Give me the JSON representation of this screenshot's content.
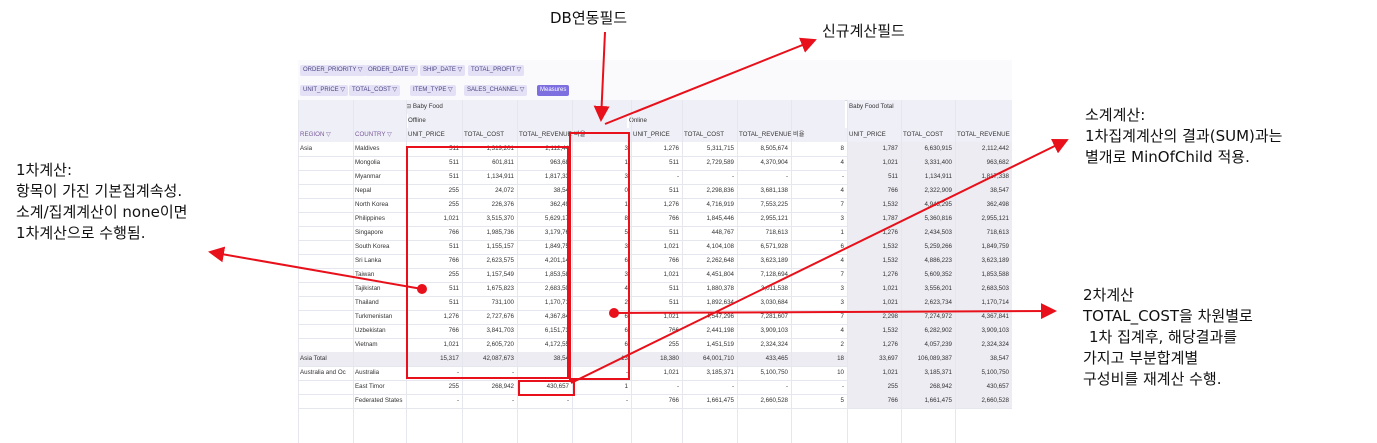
{
  "annotations": {
    "db_field": "DB연동필드",
    "new_field": "신규계산필드",
    "subtotal": [
      "소계계산:",
      "1차집계계산의 결과(SUM)과는",
      "별개로 MinOfChild 적용."
    ],
    "first_calc": [
      "1차계산:",
      "항목이 가진 기본집계속성.",
      "소계/집계계산이 none이면",
      "1차계산으로 수행됨."
    ],
    "second_calc": [
      "2차계산",
      "TOTAL_COST을 차원별로",
      "1차 집계후, 해당결과를",
      "가지고 부분합계별",
      "구성비를 재계산 수행."
    ]
  },
  "toolbar": {
    "filters": [
      "ORDER_PRIORITY ▽",
      "ORDER_DATE ▽",
      "SHIP_DATE ▽",
      "TOTAL_PROFIT ▽"
    ],
    "columns": [
      "UNIT_PRICE ▽",
      "TOTAL_COST ▽",
      "ITEM_TYPE ▽",
      "SALES_CHANNEL ▽",
      "Measures"
    ]
  },
  "colors": {
    "accent": "#7d6fe0",
    "highlight": "#e8101a"
  },
  "pivot": {
    "group": "⊟ Baby Food",
    "group_total": "Baby Food Total",
    "channels": [
      "Offline",
      "Online"
    ],
    "region_header": "REGION ▽",
    "country_header": "COUNTRY ▽",
    "measures": [
      "UNIT_PRICE",
      "TOTAL_COST",
      "TOTAL_REVENUE",
      "비율"
    ],
    "rows": [
      {
        "region": "Asia",
        "country": "Maldives",
        "v": [
          "511",
          "1,319,201",
          "2,112,44",
          "3",
          "1,276",
          "5,311,715",
          "8,505,674",
          "8",
          "1,787",
          "6,630,915",
          "2,112,442"
        ]
      },
      {
        "region": "",
        "country": "Mongolia",
        "v": [
          "511",
          "601,811",
          "963,68",
          "1",
          "511",
          "2,729,589",
          "4,370,904",
          "4",
          "1,021",
          "3,331,400",
          "963,682"
        ]
      },
      {
        "region": "",
        "country": "Myanmar",
        "v": [
          "511",
          "1,134,911",
          "1,817,33",
          "3",
          "-",
          "-",
          "-",
          "-",
          "511",
          "1,134,911",
          "1,817,338"
        ]
      },
      {
        "region": "",
        "country": "Nepal",
        "v": [
          "255",
          "24,072",
          "38,54",
          "0",
          "511",
          "2,298,836",
          "3,681,138",
          "4",
          "766",
          "2,322,909",
          "38,547"
        ]
      },
      {
        "region": "",
        "country": "North Korea",
        "v": [
          "255",
          "226,376",
          "362,49",
          "1",
          "1,276",
          "4,716,919",
          "7,553,225",
          "7",
          "1,532",
          "4,943,295",
          "362,498"
        ]
      },
      {
        "region": "",
        "country": "Philippines",
        "v": [
          "1,021",
          "3,515,370",
          "5,629,17",
          "8",
          "766",
          "1,845,446",
          "2,955,121",
          "3",
          "1,787",
          "5,360,816",
          "2,955,121"
        ]
      },
      {
        "region": "",
        "country": "Singapore",
        "v": [
          "766",
          "1,985,736",
          "3,179,76",
          "5",
          "511",
          "448,767",
          "718,613",
          "1",
          "1,276",
          "2,434,503",
          "718,613"
        ]
      },
      {
        "region": "",
        "country": "South Korea",
        "v": [
          "511",
          "1,155,157",
          "1,849,75",
          "3",
          "1,021",
          "4,104,108",
          "6,571,928",
          "6",
          "1,532",
          "5,259,266",
          "1,849,759"
        ]
      },
      {
        "region": "",
        "country": "Sri Lanka",
        "v": [
          "766",
          "2,623,575",
          "4,201,14",
          "6",
          "766",
          "2,262,648",
          "3,623,189",
          "4",
          "1,532",
          "4,886,223",
          "3,623,189"
        ]
      },
      {
        "region": "",
        "country": "Taiwan",
        "v": [
          "255",
          "1,157,549",
          "1,853,58",
          "3",
          "1,021",
          "4,451,804",
          "7,128,694",
          "7",
          "1,276",
          "5,609,352",
          "1,853,588"
        ]
      },
      {
        "region": "",
        "country": "Tajikistan",
        "v": [
          "511",
          "1,675,823",
          "2,683,50",
          "4",
          "511",
          "1,880,378",
          "3,011,538",
          "3",
          "1,021",
          "3,556,201",
          "2,683,503"
        ]
      },
      {
        "region": "",
        "country": "Thailand",
        "v": [
          "511",
          "731,100",
          "1,170,71",
          "2",
          "511",
          "1,892,634",
          "3,030,684",
          "3",
          "1,021",
          "2,623,734",
          "1,170,714"
        ]
      },
      {
        "region": "",
        "country": "Turkmenistan",
        "v": [
          "1,276",
          "2,727,676",
          "4,367,84",
          "6",
          "1,021",
          "4,547,296",
          "7,281,607",
          "7",
          "2,298",
          "7,274,972",
          "4,367,841"
        ]
      },
      {
        "region": "",
        "country": "Uzbekistan",
        "v": [
          "766",
          "3,841,703",
          "6,151,73",
          "6",
          "766",
          "2,441,198",
          "3,909,103",
          "4",
          "1,532",
          "6,282,902",
          "3,909,103"
        ]
      },
      {
        "region": "",
        "country": "Vietnam",
        "v": [
          "1,021",
          "2,605,720",
          "4,172,55",
          "6",
          "255",
          "1,451,519",
          "2,324,324",
          "2",
          "1,276",
          "4,057,239",
          "2,324,324"
        ]
      },
      {
        "region": "Asia Total",
        "country": "",
        "total": true,
        "v": [
          "15,317",
          "42,087,673",
          "38,54",
          "13",
          "18,380",
          "64,001,710",
          "433,465",
          "18",
          "33,697",
          "106,089,387",
          "38,547"
        ]
      },
      {
        "region": "Australia and Oc",
        "country": "Australia",
        "v": [
          "-",
          "-",
          "-",
          "-",
          "1,021",
          "3,185,371",
          "5,100,750",
          "10",
          "1,021",
          "3,185,371",
          "5,100,750"
        ]
      },
      {
        "region": "",
        "country": "East Timor",
        "v": [
          "255",
          "268,942",
          "430,657",
          "1",
          "-",
          "-",
          "-",
          "-",
          "255",
          "268,942",
          "430,657"
        ]
      },
      {
        "region": "",
        "country": "Federated States",
        "v": [
          "-",
          "-",
          "-",
          "-",
          "766",
          "1,661,475",
          "2,660,528",
          "5",
          "766",
          "1,661,475",
          "2,660,528"
        ]
      }
    ]
  }
}
